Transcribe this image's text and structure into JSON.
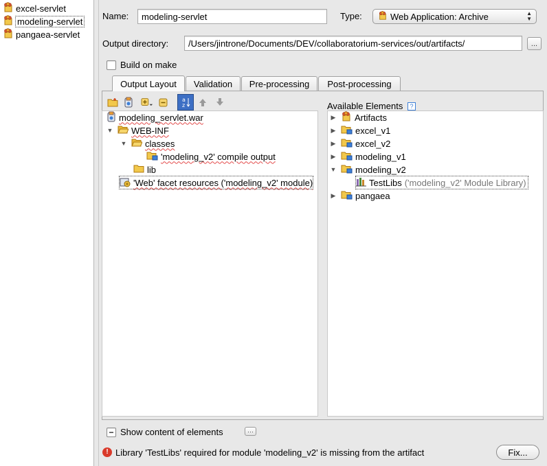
{
  "artifacts_list": [
    {
      "label": "excel-servlet",
      "selected": false
    },
    {
      "label": "modeling-servlet",
      "selected": true
    },
    {
      "label": "pangaea-servlet",
      "selected": false
    }
  ],
  "form": {
    "name_label": "Name:",
    "name_value": "modeling-servlet",
    "type_label": "Type:",
    "type_value": "Web Application: Archive",
    "output_label": "Output directory:",
    "output_value": "/Users/jintrone/Documents/DEV/collaboratorium-services/out/artifacts/",
    "browse_label": "...",
    "build_on_make_label": "Build on make",
    "build_on_make_checked": false
  },
  "tabs": [
    {
      "label": "Output Layout",
      "active": true
    },
    {
      "label": "Validation",
      "active": false
    },
    {
      "label": "Pre-processing",
      "active": false
    },
    {
      "label": "Post-processing",
      "active": false
    }
  ],
  "toolbar": {
    "icons": [
      "new-folder-icon",
      "archive-icon",
      "add-icon",
      "remove-icon",
      "sort-az-icon",
      "move-up-icon",
      "move-down-icon"
    ]
  },
  "layout_tree": [
    {
      "label": "modeling_servlet.war",
      "icon": "war-icon",
      "toggle": ""
    },
    {
      "label": "WEB-INF",
      "icon": "folder-open-icon",
      "toggle": "▼"
    },
    {
      "label": "classes",
      "icon": "folder-open-icon",
      "toggle": "▼"
    },
    {
      "label": "'modeling_v2' compile output",
      "icon": "module-folder-icon",
      "toggle": ""
    },
    {
      "label": "lib",
      "icon": "folder-icon",
      "toggle": ""
    },
    {
      "label": "'Web' facet resources ('modeling_v2' module)",
      "icon": "web-facet-icon",
      "toggle": ""
    }
  ],
  "available": {
    "header": "Available Elements",
    "help_icon": "help-icon",
    "items": [
      {
        "label": "Artifacts",
        "sub": "",
        "icon": "artifact-icon",
        "toggle": "▶"
      },
      {
        "label": "excel_v1",
        "sub": "",
        "icon": "module-folder-icon",
        "toggle": "▶"
      },
      {
        "label": "excel_v2",
        "sub": "",
        "icon": "module-folder-icon",
        "toggle": "▶"
      },
      {
        "label": "modeling_v1",
        "sub": "",
        "icon": "module-folder-icon",
        "toggle": "▶"
      },
      {
        "label": "modeling_v2",
        "sub": "",
        "icon": "module-folder-icon",
        "toggle": "▼"
      },
      {
        "label": "TestLibs",
        "sub": "('modeling_v2' Module Library)",
        "icon": "library-icon",
        "toggle": ""
      },
      {
        "label": "pangaea",
        "sub": "",
        "icon": "module-folder-icon",
        "toggle": "▶"
      }
    ]
  },
  "footer": {
    "show_content_label": "Show content of elements",
    "show_content_checked": true,
    "more_label": "···",
    "error_message": "Library 'TestLibs' required for module 'modeling_v2' is missing from the artifact",
    "fix_label": "Fix..."
  },
  "colors": {
    "error_red": "#d93a2b",
    "folder_yellow": "#f2c84b",
    "module_blue": "#3c7fd8",
    "selection_blue": "#3d6fc4"
  }
}
